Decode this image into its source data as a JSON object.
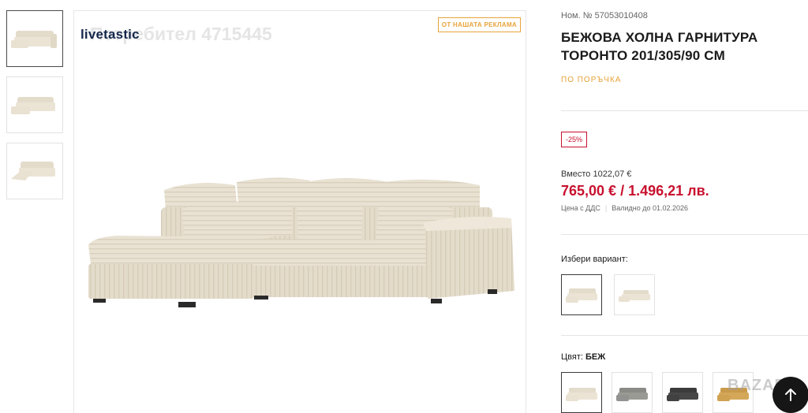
{
  "watermark": "Потребител 4715445",
  "brand": {
    "name": "livetastic"
  },
  "ad_badge": "ОТ НАШАТА РЕКЛАМА",
  "product": {
    "sku": "Ном. № 57053010408",
    "title": "БЕЖОВА ХОЛНА ГАРНИТУРА ТОРОНТО 201/305/90 СМ",
    "availability": "ПО ПОРЪЧКА",
    "discount": "-25%",
    "old_price": "Вместо 1022,07 €",
    "price": "765,00 € / 1.496,21 лв.",
    "vat_note": "Цена с ДДС",
    "valid_until": "Валидно до 01.02.2026"
  },
  "variants": {
    "label": "Избери вариант:"
  },
  "colors": {
    "label": "Цвят: ",
    "selected": "БЕЖ"
  },
  "corner_watermark": "BAZAR",
  "palette": {
    "sofa": "#e7dfcf",
    "grey": "#8a8a86",
    "dark": "#3b3b3b",
    "mustard": "#c99a4a",
    "price_red": "#c8102e",
    "accent_orange": "#e8a33a"
  }
}
